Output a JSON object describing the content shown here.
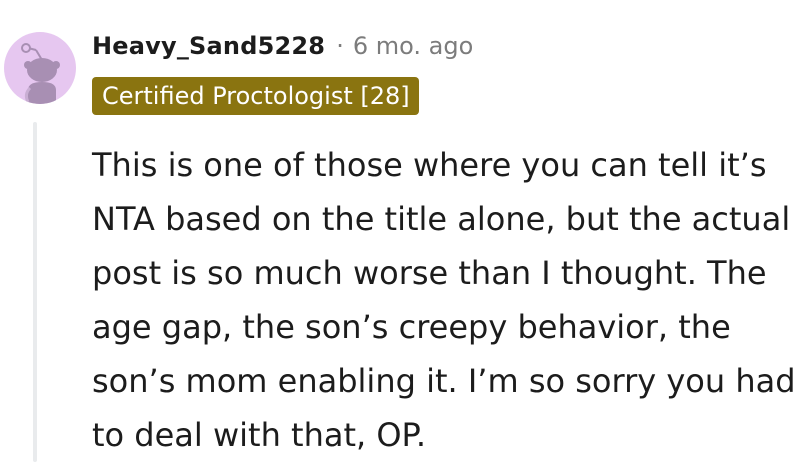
{
  "comment": {
    "author": "Heavy_Sand5228",
    "separator": "·",
    "timestamp": "6 mo. ago",
    "flair": "Certified Proctologist [28]",
    "body": "This is one of those where you can tell it’s NTA based on the title alone, but the actual post is so much worse than I thought. The age gap, the son’s creepy behavior, the son’s mom enabling it. I’m so sorry you had to deal with that, OP."
  },
  "colors": {
    "flair_background": "#8a7410",
    "avatar_background": "#e6c7f0",
    "avatar_figure": "#a88fb3",
    "meta_text": "#7c7c7c",
    "thread_line": "#e9ebed"
  },
  "icons": {
    "avatar": "default-snoo-avatar-icon"
  }
}
